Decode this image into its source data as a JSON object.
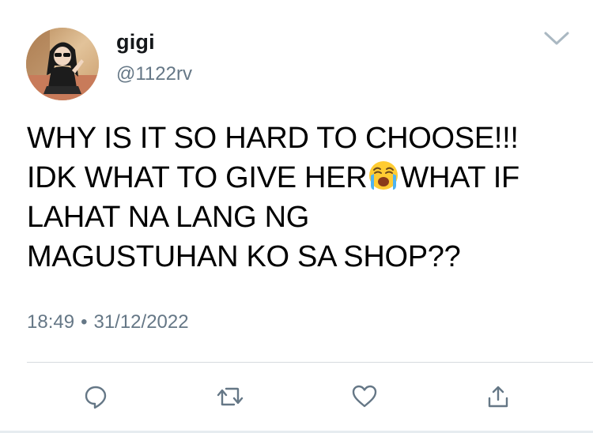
{
  "user": {
    "display_name": "gigi",
    "handle": "@1122rv",
    "avatar_icon": "user-avatar"
  },
  "tweet": {
    "lines": [
      "WHY IS IT SO HARD TO CHOOSE!!!",
      "IDK WHAT TO GIVE HER",
      "WHAT IF",
      "LAHAT NA LANG NG",
      "MAGUSTUHAN KO SA SHOP??"
    ],
    "emoji": "loudly-crying-face",
    "time": "18:49",
    "separator": "•",
    "date": "31/12/2022"
  },
  "actions": {
    "reply_icon": "reply-icon",
    "retweet_icon": "retweet-icon",
    "like_icon": "heart-icon",
    "share_icon": "share-icon"
  },
  "colors": {
    "text": "#000000",
    "secondary": "#657786",
    "icon": "#657786",
    "divider": "#d6dbdf"
  }
}
